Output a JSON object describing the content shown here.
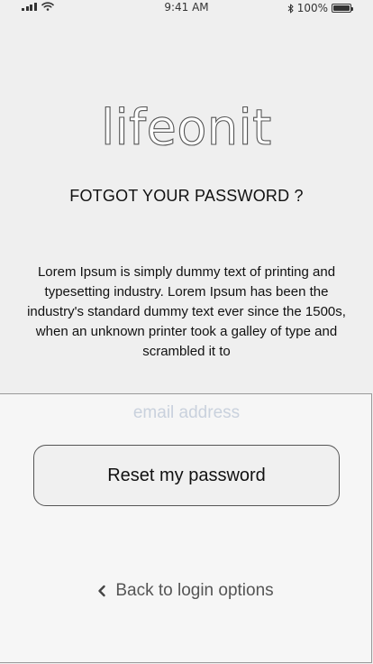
{
  "status_bar": {
    "time": "9:41 AM",
    "battery_text": "100%",
    "battery_level": 1.0
  },
  "logo": {
    "text": "lifeonit"
  },
  "page": {
    "title": "FOTGOT YOUR PASSWORD ?",
    "description": "Lorem Ipsum is simply dummy text of printing and typesetting industry. Lorem Ipsum has been the industry's standard dummy text ever since the 1500s, when an unknown printer took a galley of type and scrambled it to"
  },
  "form": {
    "email_placeholder": "email address",
    "email_value": "",
    "reset_label": "Reset my password",
    "back_label": "Back to login options"
  },
  "icons": {
    "signal": "signal-bars-icon",
    "wifi": "wifi-icon",
    "bluetooth": "bluetooth-icon",
    "battery": "battery-icon",
    "back": "chevron-left-icon"
  }
}
